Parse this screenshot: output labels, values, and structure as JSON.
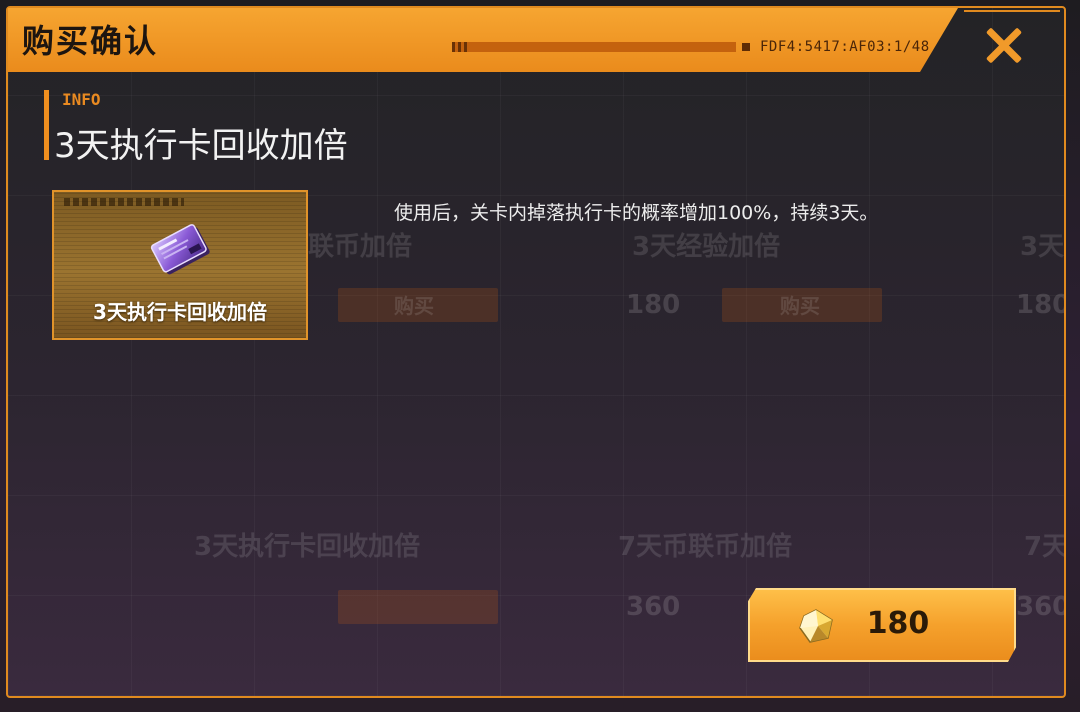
{
  "dialog": {
    "title": "购买确认",
    "header_code": "FDF4:5417:AF03:1/48",
    "close_icon": "close-x-icon"
  },
  "item": {
    "info_tag": "INFO",
    "name": "3天执行卡回收加倍",
    "card_label": "3天执行卡回收加倍",
    "description": "使用后，关卡内掉落执行卡的概率增加100%，持续3天。",
    "card_icon": "execution-card-icon"
  },
  "background_items": {
    "row1": [
      "联币加倍",
      "3天经验加倍",
      "3天"
    ],
    "row1_buttons": [
      "购买",
      "购买"
    ],
    "row1_prices": [
      "180",
      "180"
    ],
    "row2": [
      "3天执行卡回收加倍",
      "7天币联币加倍",
      "7天"
    ],
    "row2_prices": [
      "360",
      "360"
    ]
  },
  "purchase": {
    "price": "180",
    "currency_icon": "gem-currency-icon"
  },
  "colors": {
    "accent": "#f08f1f",
    "header": "#f6a531",
    "button": "#f5a12c"
  }
}
